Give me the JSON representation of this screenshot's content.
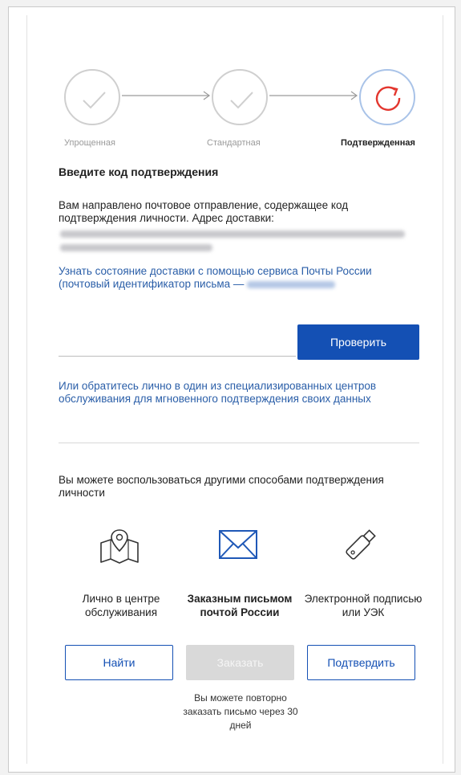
{
  "steps": [
    {
      "label": "Упрощенная",
      "state": "done"
    },
    {
      "label": "Стандартная",
      "state": "done"
    },
    {
      "label": "Подтвержденная",
      "state": "current"
    }
  ],
  "confirm": {
    "title": "Введите код подтверждения",
    "description": "Вам направлено почтовое отправление, содержащее код подтверждения личности. Адрес доставки:",
    "tracking_link": "Узнать состояние доставки с помощью сервиса Почты России (почтовый идентификатор письма —",
    "code_placeholder": "",
    "check_button": "Проверить",
    "service_center_link": "Или обратитесь лично в один из специализированных центров обслуживания для мгновенного подтверждения своих данных"
  },
  "other_methods": {
    "intro": "Вы можете воспользоваться другими способами подтверждения личности",
    "items": [
      {
        "label": "Лично в центре обслуживания",
        "icon": "map-icon",
        "button": "Найти"
      },
      {
        "label": "Заказным письмом почтой России",
        "icon": "envelope-icon",
        "button": "Заказать"
      },
      {
        "label": "Электронной подписью или УЭК",
        "icon": "usb-key-icon",
        "button": "Подтвердить"
      }
    ],
    "reorder_note": "Вы можете повторно заказать письмо через 30 дней"
  },
  "colors": {
    "primary": "#1450b4",
    "link": "#2a5ea8",
    "accent_red": "#e3362e"
  }
}
